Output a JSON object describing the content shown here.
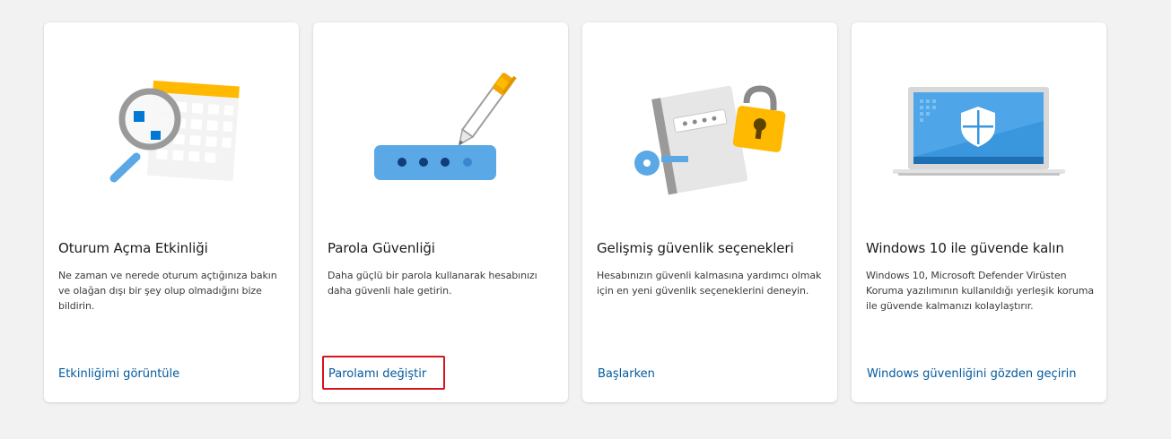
{
  "cards": [
    {
      "title": "Oturum Açma Etkinliği",
      "description": "Ne zaman ve nerede oturum açtığınıza bakın ve olağan dışı bir şey olup olmadığını bize bildirin.",
      "link": "Etkinliğimi görüntüle",
      "illustration": "magnifier-calendar-icon"
    },
    {
      "title": "Parola Güvenliği",
      "description": "Daha güçlü bir parola kullanarak hesabınızı daha güvenli hale getirin.",
      "link": "Parolamı değiştir",
      "illustration": "password-pen-icon"
    },
    {
      "title": "Gelişmiş güvenlik seçenekleri",
      "description": "Hesabınızın güvenli kalmasına yardımcı olmak için en yeni güvenlik seçeneklerini deneyin.",
      "link": "Başlarken",
      "illustration": "key-notebook-lock-icon"
    },
    {
      "title": "Windows 10 ile güvende kalın",
      "description": "Windows 10, Microsoft Defender Virüsten Koruma yazılımının kullanıldığı yerleşik koruma ile güvende kalmanızı kolaylaştırır.",
      "link": "Windows güvenliğini gözden geçirin",
      "illustration": "laptop-shield-icon"
    }
  ],
  "colors": {
    "background": "#f2f2f2",
    "card": "#ffffff",
    "link": "#005a9e",
    "highlight": "#d6141b",
    "accent_blue": "#0078d4",
    "accent_yellow": "#ffb900"
  }
}
